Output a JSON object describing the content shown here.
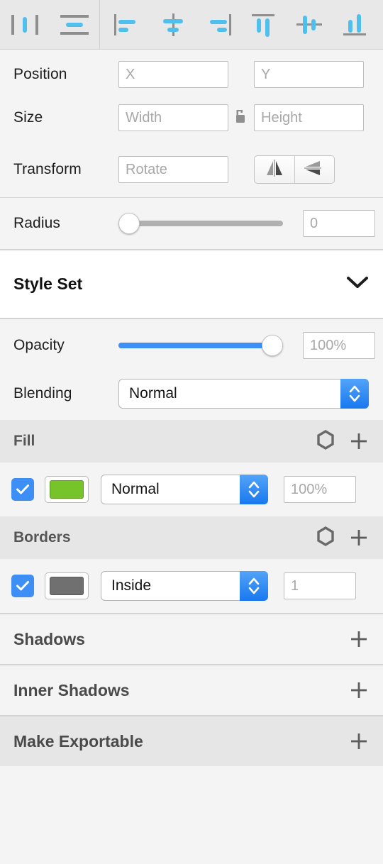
{
  "toolbar": {
    "distribute": [
      {
        "name": "distribute-horizontally",
        "label": "Distribute Horizontally"
      },
      {
        "name": "distribute-vertically",
        "label": "Distribute Vertically"
      }
    ],
    "align": [
      {
        "name": "align-left",
        "label": "Align Left"
      },
      {
        "name": "align-horizontal-center",
        "label": "Align Horizontal Center"
      },
      {
        "name": "align-right",
        "label": "Align Right"
      },
      {
        "name": "align-top",
        "label": "Align Top"
      },
      {
        "name": "align-vertical-center",
        "label": "Align Vertical Center"
      },
      {
        "name": "align-bottom",
        "label": "Align Bottom"
      }
    ]
  },
  "position": {
    "label": "Position",
    "x_value": "",
    "x_placeholder": "X",
    "y_value": "",
    "y_placeholder": "Y"
  },
  "size": {
    "label": "Size",
    "width_value": "",
    "width_placeholder": "Width",
    "height_value": "",
    "height_placeholder": "Height",
    "lock_icon": "unlocked-padlock-icon",
    "lock_state": "unlocked"
  },
  "transform": {
    "label": "Transform",
    "rotate_value": "",
    "rotate_placeholder": "Rotate",
    "flip_horizontal_label": "Flip Horizontal",
    "flip_vertical_label": "Flip Vertical"
  },
  "radius": {
    "label": "Radius",
    "value": "0",
    "slider_percent": 0,
    "min": 0,
    "max": 100
  },
  "style_set": {
    "label": "Style Set",
    "chevron": "chevron-down-icon"
  },
  "opacity": {
    "label": "Opacity",
    "value": "100%",
    "slider_percent": 100
  },
  "blending": {
    "label": "Blending",
    "value": "Normal"
  },
  "fill": {
    "header": "Fill",
    "settings_icon": "hexagon-settings-icon",
    "add_icon": "plus-icon",
    "enabled": true,
    "color": "#76c42a",
    "blend_mode": "Normal",
    "opacity": "100%"
  },
  "borders": {
    "header": "Borders",
    "settings_icon": "hexagon-settings-icon",
    "add_icon": "plus-icon",
    "enabled": true,
    "color": "#707070",
    "position": "Inside",
    "thickness": "1"
  },
  "collapsed_sections": [
    {
      "label": "Shadows",
      "name": "shadows",
      "add_icon": "plus-icon",
      "dark": false
    },
    {
      "label": "Inner Shadows",
      "name": "inner-shadows",
      "add_icon": "plus-icon",
      "dark": false
    },
    {
      "label": "Make Exportable",
      "name": "make-exportable",
      "add_icon": "plus-icon",
      "dark": true
    }
  ],
  "colors": {
    "accent_blue": "#3d8ff5",
    "icon_blue": "#4fc0ee",
    "icon_gray": "#8e8e8e",
    "panel_bg": "#f4f4f4",
    "header_bg": "#e6e6e6"
  }
}
